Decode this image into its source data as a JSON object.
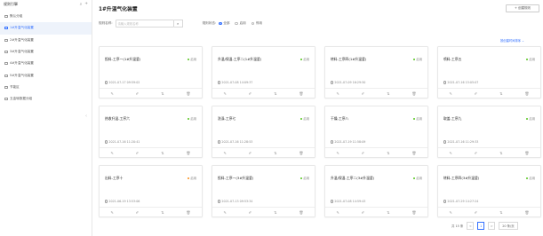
{
  "sidebar": {
    "title": "规则引擎",
    "items": [
      {
        "label": "默认分组",
        "active": false
      },
      {
        "label": "1#升温气化装置",
        "active": true
      },
      {
        "label": "2#升温气化装置",
        "active": false
      },
      {
        "label": "3#升温气化装置",
        "active": false
      },
      {
        "label": "4#升温气化装置",
        "active": false
      },
      {
        "label": "5#升温气化装置",
        "active": false
      },
      {
        "label": "节能区",
        "active": false
      },
      {
        "label": "五金转数据分组",
        "active": false
      }
    ]
  },
  "main": {
    "title": "1#升温气化装置",
    "create_label": "+ 创建规则",
    "filter": {
      "name_label": "规则名称:",
      "name_placeholder": "请输入规则名称",
      "status_label": "规则状态:",
      "options": [
        {
          "label": "全部",
          "checked": true
        },
        {
          "label": "启用",
          "checked": false
        },
        {
          "label": "停用",
          "checked": false
        }
      ]
    },
    "sort_label": "按创建时间排序 ⌄",
    "cards": [
      {
        "name": "投料-工序一(1#升温釜)",
        "status": "启用",
        "time": "2021-07-17 09:59:02"
      },
      {
        "name": "升温/保温-工序二(1#升温釜)",
        "status": "启用",
        "time": "2021-07-08 14:09:37"
      },
      {
        "name": "转料-工序四(1#升温釜)",
        "status": "启用",
        "time": "2021-07-09 16:29:50"
      },
      {
        "name": "喷料-工序五",
        "status": "启用",
        "time": "2021-07-16 15:05:07"
      },
      {
        "name": "热收升温-工序六",
        "status": "启用",
        "time": "2021-07-16 11:20:41"
      },
      {
        "name": "洗涤-工序七",
        "status": "启用",
        "time": "2021-07-16 11:28:53"
      },
      {
        "name": "干燥-工序八",
        "status": "启用",
        "time": "2021-07-19 11:58:09"
      },
      {
        "name": "取盖-工序九",
        "status": "启用",
        "time": "2021-07-16 11:29:33"
      },
      {
        "name": "出料-工序十",
        "status": "启用",
        "time": "2021-06-19 13:53:06"
      },
      {
        "name": "投料-工序一(3#升温釜)",
        "status": "启用",
        "time": "2021-07-13 09:53:34"
      },
      {
        "name": "升温/保温-工序二(3#升温釜)",
        "status": "启用",
        "time": "2021-07-08 14:59:43"
      },
      {
        "name": "转料-工序四(3#升温釜)",
        "status": "启用",
        "time": "2021-07-29 14:27:24"
      }
    ],
    "pager": {
      "total": "共 15 条",
      "prev": "<",
      "current": "1",
      "next": ">",
      "size": "20 条/页"
    }
  },
  "colors": {
    "accent": "#3370ff",
    "status_green": "#52c41a",
    "status_orange": "#fa8c16"
  }
}
